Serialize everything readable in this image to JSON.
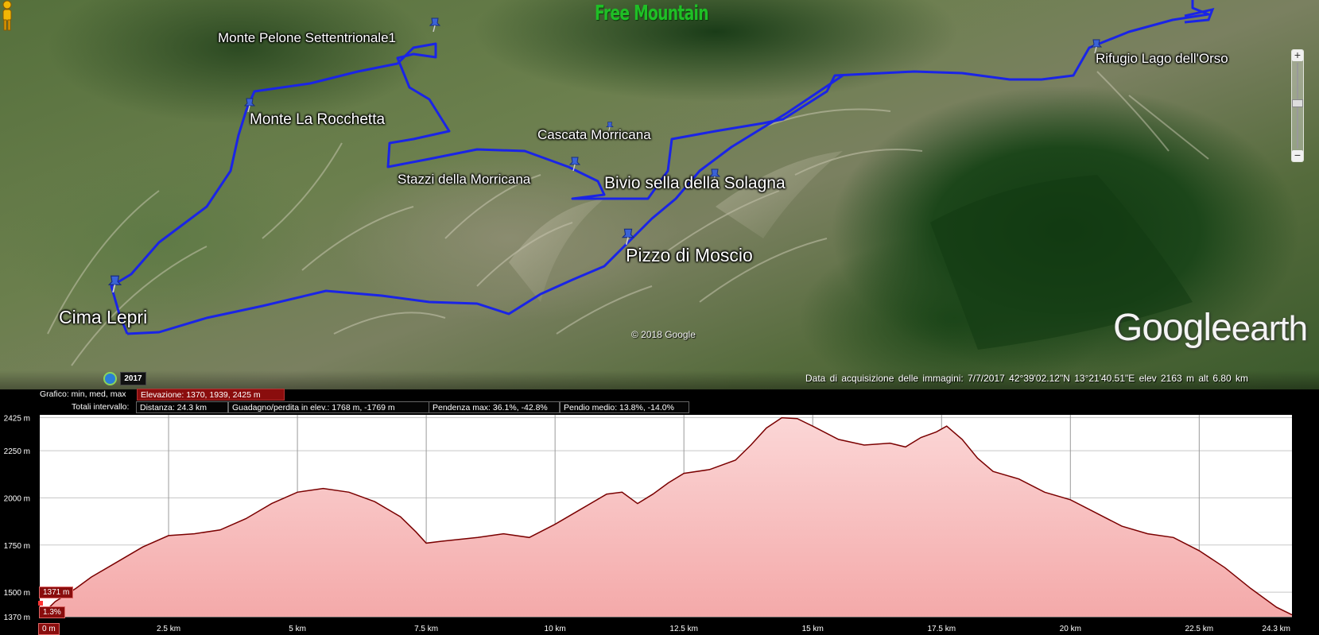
{
  "brand": "Free Mountain",
  "map": {
    "places": [
      {
        "label": "Monte Pelone Settentrionale1"
      },
      {
        "label": "Monte La Rocchetta"
      },
      {
        "label": "Cascata Morricana"
      },
      {
        "label": "Stazzi della Morricana"
      },
      {
        "label": "Bivio sella della Solagna"
      },
      {
        "label": "Pizzo di Moscio"
      },
      {
        "label": "Cima Lepri"
      },
      {
        "label": "Rifugio Lago dell'Orso"
      }
    ],
    "copyright": "© 2018 Google",
    "logo": {
      "google": "Google",
      "earth": "earth"
    },
    "timeline_year": "2017",
    "status": "Data di acquisizione delle immagini: 7/7/2017     42°39'02.12\"N   13°21'40.51\"E   elev  2163 m      alt   6.80 km",
    "route_color": "#1a24e6",
    "icons": [
      "pushpin-icon",
      "pegman-icon",
      "clock-icon",
      "zoom-plus-icon",
      "zoom-minus-icon"
    ]
  },
  "profile": {
    "graph_label": "Grafico: min, med, max",
    "elevation": "Elevazione: 1370, 1939, 2425 m",
    "totals_label": "Totali intervallo:",
    "distance": "Distanza: 24.3 km",
    "gain_loss": "Guadagno/perdita in elev.: 1768 m, -1769 m",
    "max_slope": "Pendenza max: 36.1%, -42.8%",
    "avg_slope": "Pendio medio: 13.8%, -14.0%",
    "current_elev": "1371 m",
    "current_grade": "1.3%",
    "current_dist": "0 m"
  },
  "chart_data": {
    "type": "area",
    "title": "",
    "xlabel": "",
    "ylabel": "",
    "y_ticks": [
      "2425 m",
      "2250 m",
      "2000 m",
      "1750 m",
      "1500 m",
      "1370 m"
    ],
    "y_tick_values": [
      2425,
      2250,
      2000,
      1750,
      1500,
      1370
    ],
    "x_ticks": [
      "0 m",
      "2.5 km",
      "5 km",
      "7.5 km",
      "10 km",
      "12.5 km",
      "15 km",
      "17.5 km",
      "20 km",
      "22.5 km",
      "24.3 km"
    ],
    "x_tick_values": [
      0,
      2.5,
      5,
      7.5,
      10,
      12.5,
      15,
      17.5,
      20,
      22.5,
      24.3
    ],
    "xlim": [
      0,
      24.3
    ],
    "ylim": [
      1370,
      2440
    ],
    "grid": true,
    "fill_color": "#f5b5b5",
    "line_color": "#7a0000",
    "series": [
      {
        "x": [
          0,
          0.3,
          0.7,
          1.0,
          1.5,
          2.0,
          2.5,
          3.0,
          3.5,
          4.0,
          4.5,
          5.0,
          5.5,
          6.0,
          6.5,
          7.0,
          7.3,
          7.5,
          7.8,
          8.5,
          9.0,
          9.5,
          10.0,
          10.5,
          11.0,
          11.3,
          11.6,
          11.9,
          12.2,
          12.5,
          13.0,
          13.5,
          13.8,
          14.1,
          14.4,
          14.7,
          15.0,
          15.5,
          16.0,
          16.5,
          16.8,
          17.1,
          17.4,
          17.6,
          17.9,
          18.2,
          18.5,
          19.0,
          19.5,
          20.0,
          20.5,
          21.0,
          21.5,
          22.0,
          22.5,
          23.0,
          23.5,
          24.0,
          24.3
        ],
        "y": [
          1371,
          1450,
          1520,
          1580,
          1660,
          1740,
          1800,
          1810,
          1830,
          1890,
          1970,
          2030,
          2050,
          2030,
          1980,
          1900,
          1820,
          1760,
          1770,
          1790,
          1810,
          1790,
          1860,
          1940,
          2020,
          2030,
          1970,
          2020,
          2080,
          2130,
          2150,
          2200,
          2280,
          2370,
          2425,
          2420,
          2380,
          2310,
          2280,
          2290,
          2270,
          2320,
          2350,
          2380,
          2310,
          2210,
          2140,
          2100,
          2030,
          1990,
          1920,
          1850,
          1810,
          1790,
          1720,
          1630,
          1520,
          1420,
          1380
        ]
      }
    ]
  }
}
